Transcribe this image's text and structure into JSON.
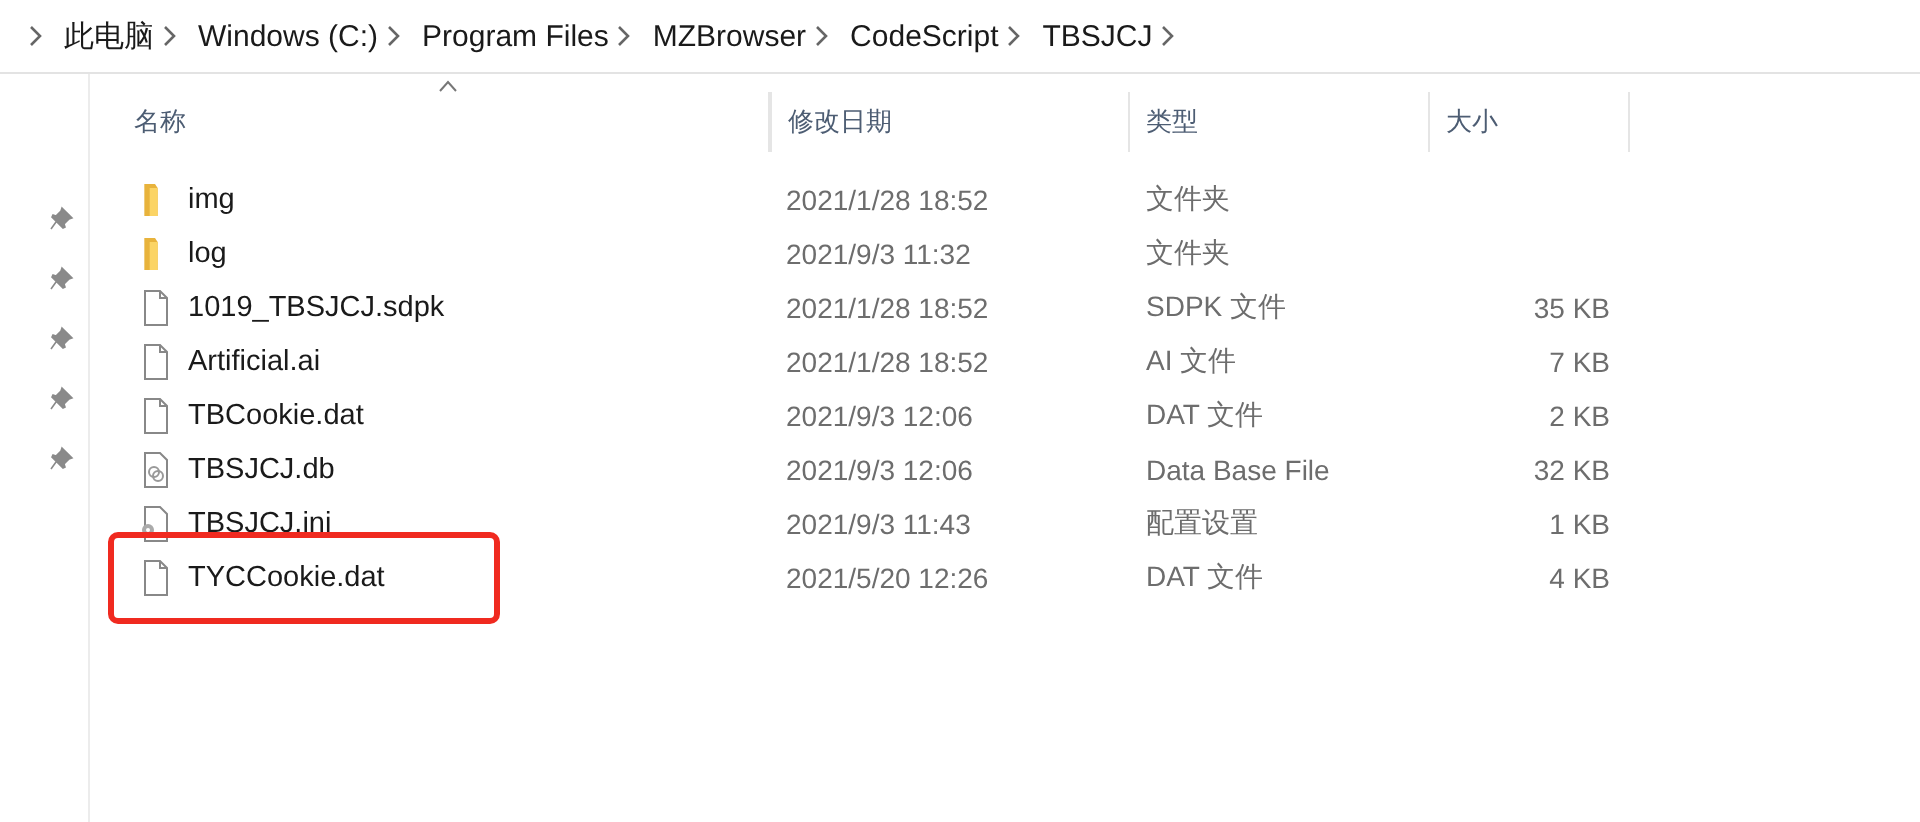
{
  "breadcrumb": [
    "此电脑",
    "Windows (C:)",
    "Program Files",
    "MZBrowser",
    "CodeScript",
    "TBSJCJ"
  ],
  "quick_access_pins": [
    {
      "pinned": true
    },
    {
      "pinned": true
    },
    {
      "pinned": true
    },
    {
      "pinned": true
    },
    {
      "pinned": true
    }
  ],
  "table": {
    "columns": [
      "名称",
      "修改日期",
      "类型",
      "大小"
    ],
    "rows": [
      {
        "kind": "folder",
        "name": "img",
        "date": "2021/1/28 18:52",
        "type": "文件夹",
        "highlighted": false
      },
      {
        "kind": "folder",
        "name": "log",
        "date": "2021/9/3 11:32",
        "type": "文件夹",
        "highlighted": false
      },
      {
        "kind": "file",
        "name": "1019_TBSJCJ.sdpk",
        "date": "2021/1/28 18:52",
        "type": "SDPK 文件",
        "size": "35 KB",
        "highlighted": false
      },
      {
        "kind": "file",
        "name": "Artificial.ai",
        "date": "2021/1/28 18:52",
        "type": "AI 文件",
        "size": "7 KB",
        "highlighted": false
      },
      {
        "kind": "file",
        "name": "TBCookie.dat",
        "date": "2021/9/3 12:06",
        "type": "DAT 文件",
        "size": "2 KB",
        "highlighted": false
      },
      {
        "kind": "database",
        "name": "TBSJCJ.db",
        "date": "2021/9/3 12:06",
        "type": "Data Base File",
        "size": "32 KB",
        "highlighted": false
      },
      {
        "kind": "settings",
        "name": "TBSJCJ.ini",
        "date": "2021/9/3 11:43",
        "type": "配置设置",
        "size": "1 KB",
        "highlighted": false
      },
      {
        "kind": "file",
        "name": "TYCCookie.dat",
        "date": "2021/5/20 12:26",
        "type": "DAT 文件",
        "size": "4 KB",
        "highlighted": true
      }
    ]
  }
}
